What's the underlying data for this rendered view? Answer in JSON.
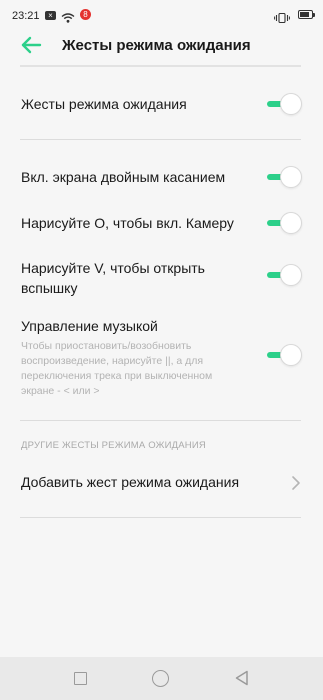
{
  "status_bar": {
    "time": "23:21",
    "notification_badge": "8",
    "icons": [
      "close-notification-icon",
      "wifi-icon",
      "notification-badge",
      "vibrate-icon",
      "battery-icon"
    ]
  },
  "header": {
    "title": "Жесты режима ожидания",
    "back_icon": "arrow-left-icon",
    "accent_color": "#2cd08a"
  },
  "main_toggle": {
    "label": "Жесты режима ожидания",
    "enabled": true
  },
  "gestures": [
    {
      "label": "Вкл. экрана двойным касанием",
      "enabled": true
    },
    {
      "label": "Нарисуйте O, чтобы вкл. Камеру",
      "enabled": true
    },
    {
      "label": "Нарисуйте V, чтобы открыть вспышку",
      "enabled": true
    },
    {
      "label": "Управление музыкой",
      "description": "Чтобы приостановить/возобновить воспроизведение, нарисуйте ||, а для переключения трека при выключенном экране - < или >",
      "enabled": true
    }
  ],
  "other_gestures": {
    "section_title": "ДРУГИЕ ЖЕСТЫ РЕЖИМА ОЖИДАНИЯ",
    "add_label": "Добавить жест режима ожидания"
  },
  "nav_bar": {
    "buttons": [
      "recent-apps-icon",
      "home-icon",
      "back-triangle-icon"
    ]
  }
}
